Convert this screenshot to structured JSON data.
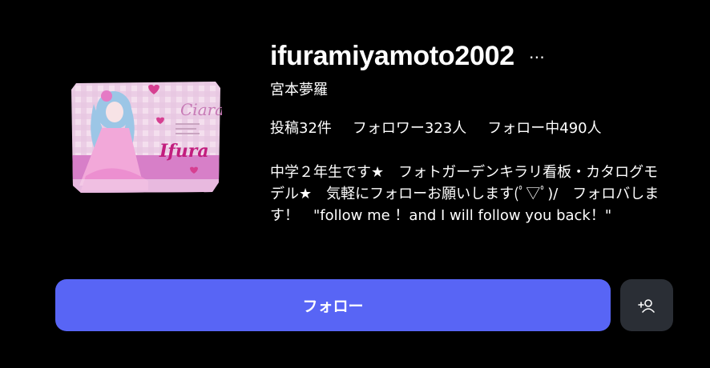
{
  "profile": {
    "username": "ifuramiyamoto2002",
    "more_icon": "…",
    "full_name": "宮本夢羅",
    "stats": {
      "posts": "投稿32件",
      "followers": "フォロワー323人",
      "following": "フォロー中490人"
    },
    "bio": "中学２年生です★　フォトガーデンキラリ看板・カタログモデル★　気軽にフォローお願いします(ﾟ▽ﾟ)/　フォロバします！　\"follow me ！and I will follow you back！\"",
    "avatar": {
      "text_top": "Ciara",
      "text_main": "Ifura"
    }
  },
  "actions": {
    "follow_label": "フォロー",
    "add_user_icon": "add-user-icon"
  },
  "colors": {
    "follow_button": "#5865f5",
    "secondary_button": "#2a2e35",
    "background": "#000000"
  }
}
